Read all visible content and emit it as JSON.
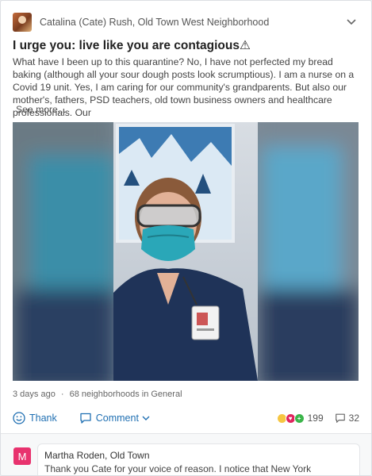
{
  "post": {
    "author": "Catalina (Cate) Rush, Old Town West Neighborhood",
    "title": "I urge you: live like you are contagious⚠",
    "body": "What have I been up to this quarantine? No, I have not perfected my bread baking (although all your sour dough posts look scrumptious). I am a nurse on a Covid 19 unit. Yes, I am caring for our community's grandparents. But also our mother's, fathers, PSD teachers, old town business owners and healthcare professionals. Our",
    "see_more": "See more...",
    "time": "3 days ago",
    "separator": "·",
    "audience": "68 neighborhoods in General"
  },
  "actions": {
    "thank": "Thank",
    "comment": "Comment",
    "reaction_count": "199",
    "comment_count": "32"
  },
  "comment": {
    "avatar_letter": "M",
    "author": "Martha Roden, Old Town",
    "text": "Thank you Cate for your voice of reason. I notice that New York Governor, Andrew Cuomo is using Zentific data...."
  },
  "colors": {
    "link": "#1f6fb2",
    "comment_avatar": "#e8326e"
  }
}
